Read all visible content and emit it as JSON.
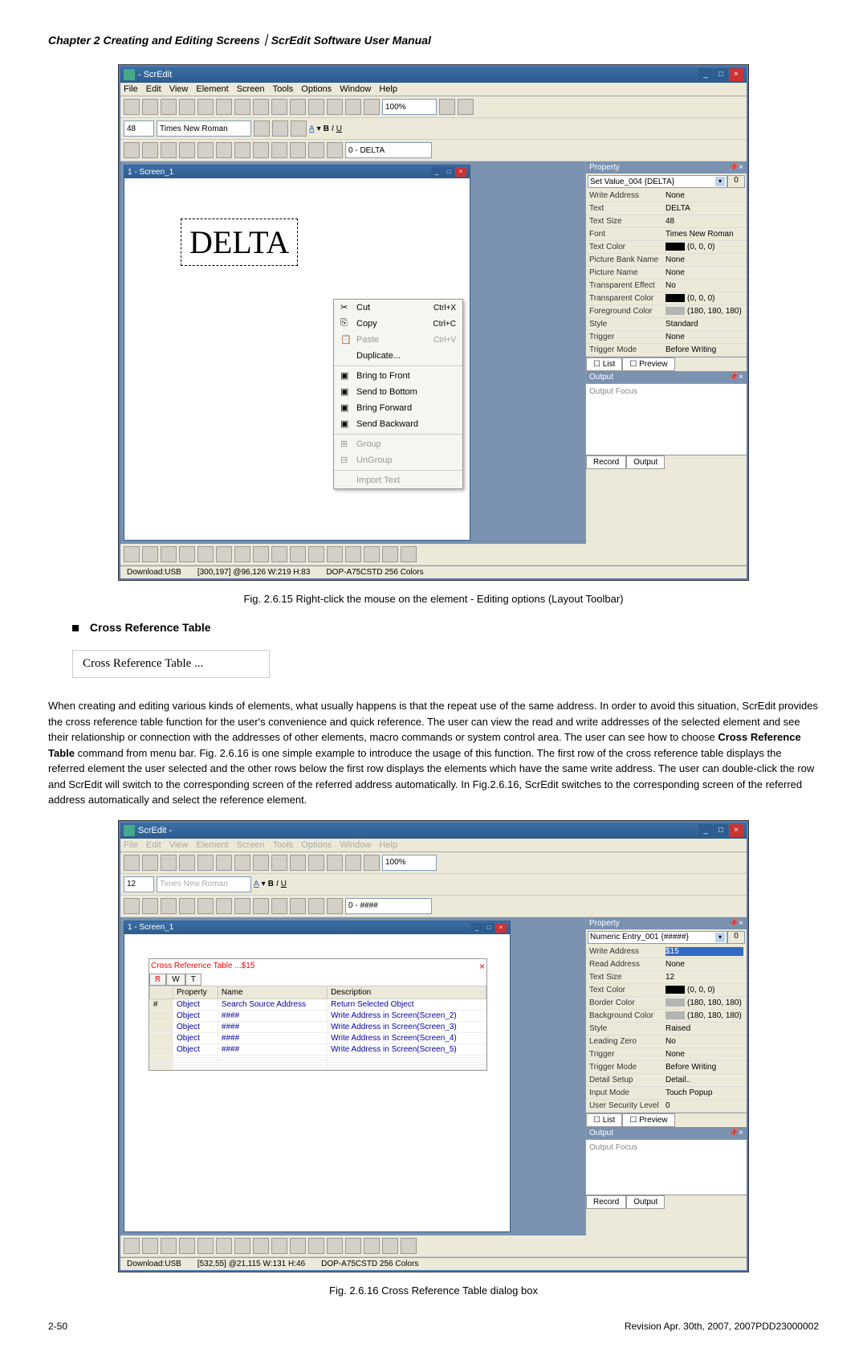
{
  "chapter_header": "Chapter 2  Creating and Editing Screens｜ScrEdit Software User Manual",
  "screenshot1": {
    "title": "- ScrEdit",
    "menubar": [
      "File",
      "Edit",
      "View",
      "Element",
      "Screen",
      "Tools",
      "Options",
      "Window",
      "Help"
    ],
    "zoom": "100%",
    "font_size": "48",
    "font_name": "Times New Roman",
    "screen_dropdown": "0 - DELTA",
    "inner_window_title": "1 - Screen_1",
    "element_text": "DELTA",
    "context_menu": [
      {
        "icon": "cut-icon",
        "label": "Cut",
        "shortcut": "Ctrl+X"
      },
      {
        "icon": "copy-icon",
        "label": "Copy",
        "shortcut": "Ctrl+C"
      },
      {
        "icon": "paste-icon",
        "label": "Paste",
        "shortcut": "Ctrl+V",
        "disabled": true
      },
      {
        "label": "Duplicate..."
      },
      {
        "divider": true
      },
      {
        "icon": "front-icon",
        "label": "Bring to Front"
      },
      {
        "icon": "bottom-icon",
        "label": "Send to Bottom"
      },
      {
        "icon": "forward-icon",
        "label": "Bring Forward"
      },
      {
        "icon": "backward-icon",
        "label": "Send Backward"
      },
      {
        "divider": true
      },
      {
        "icon": "group-icon",
        "label": "Group",
        "disabled": true
      },
      {
        "icon": "ungroup-icon",
        "label": "UnGroup",
        "disabled": true
      },
      {
        "divider": true
      },
      {
        "label": "Import Text",
        "disabled": true
      }
    ],
    "property_panel": {
      "header": "Property",
      "dropdown": "Set Value_004 {DELTA}",
      "dropdown_value": "0",
      "rows": [
        {
          "label": "Write Address",
          "value": "None"
        },
        {
          "label": "Text",
          "value": "DELTA",
          "highlighted": true
        },
        {
          "label": "Text Size",
          "value": "48"
        },
        {
          "label": "Font",
          "value": "Times New Roman"
        },
        {
          "label": "Text Color",
          "value": "(0, 0, 0)",
          "color": "black"
        },
        {
          "label": "Picture Bank Name",
          "value": "None"
        },
        {
          "label": "Picture Name",
          "value": "None"
        },
        {
          "label": "Transparent Effect",
          "value": "No"
        },
        {
          "label": "Transparent Color",
          "value": "(0, 0, 0)",
          "color": "black"
        },
        {
          "label": "Foreground Color",
          "value": "(180, 180, 180)",
          "color": "gray"
        },
        {
          "label": "Style",
          "value": "Standard"
        },
        {
          "label": "Trigger",
          "value": "None"
        },
        {
          "label": "Trigger Mode",
          "value": "Before Writing"
        }
      ],
      "tabs": [
        "List",
        "Preview"
      ]
    },
    "output_panel": {
      "header": "Output",
      "content": "Output Focus",
      "tabs": [
        "Record",
        "Output"
      ]
    },
    "statusbar": {
      "download": "Download:USB",
      "coords": "[300,197] @96,126 W:219 H:83",
      "device": "DOP-A75CSTD 256 Colors"
    }
  },
  "figure1_caption": "Fig. 2.6.15 Right-click the mouse on the element - Editing options (Layout Toolbar)",
  "section_title": "Cross Reference Table",
  "crt_label": "Cross Reference Table ...",
  "body_paragraph": "When creating and editing various kinds of elements, what usually happens is that the repeat use of the same address. In order to avoid this situation, ScrEdit provides the cross reference table function for the user's convenience and quick reference. The user can view the read and write addresses of the selected element and see their relationship or connection with the addresses of other elements, macro commands or system control area. The user can see how to choose ",
  "body_bold": "Cross Reference Table",
  "body_paragraph2": " command from menu bar. Fig. 2.6.16 is one simple example to introduce the usage of this function. The first row of the cross reference table displays the referred element the user selected and the other rows below the first row displays the elements which have the same write address. The user can double-click the row and ScrEdit will switch to the corresponding screen of the referred address automatically. In Fig.2.6.16, ScrEdit switches to the corresponding screen of the referred address automatically and select the reference element.",
  "screenshot2": {
    "title": "ScrEdit -",
    "menubar": [
      "File",
      "Edit",
      "View",
      "Element",
      "Screen",
      "Tools",
      "Options",
      "Window",
      "Help"
    ],
    "zoom": "100%",
    "font_size": "12",
    "font_name": "Times New Roman",
    "screen_dropdown": "0 - ####",
    "inner_window_title": "1 - Screen_1",
    "crt_window": {
      "title": "Cross Reference Table ...$15",
      "tabs": [
        "R",
        "W",
        "T"
      ],
      "columns": [
        "Property",
        "Name",
        "Description"
      ],
      "rows": [
        {
          "num": "#",
          "property": "Object",
          "name": "Search Source Address",
          "desc": "Return Selected Object"
        },
        {
          "property": "Object",
          "name": "####",
          "desc": "Write Address in Screen(Screen_2)"
        },
        {
          "property": "Object",
          "name": "####",
          "desc": "Write Address in Screen(Screen_3)"
        },
        {
          "property": "Object",
          "name": "####",
          "desc": "Write Address in Screen(Screen_4)"
        },
        {
          "property": "Object",
          "name": "####",
          "desc": "Write Address in Screen(Screen_5)"
        }
      ]
    },
    "property_panel": {
      "header": "Property",
      "dropdown": "Numeric Entry_001 {#####}",
      "dropdown_value": "0",
      "rows": [
        {
          "label": "Write Address",
          "value": "$15",
          "highlighted": true
        },
        {
          "label": "Read Address",
          "value": "None"
        },
        {
          "label": "Text Size",
          "value": "12"
        },
        {
          "label": "Text Color",
          "value": "(0, 0, 0)",
          "color": "black"
        },
        {
          "label": "Border Color",
          "value": "(180, 180, 180)",
          "color": "gray"
        },
        {
          "label": "Background Color",
          "value": "(180, 180, 180)",
          "color": "gray"
        },
        {
          "label": "Style",
          "value": "Raised"
        },
        {
          "label": "Leading Zero",
          "value": "No"
        },
        {
          "label": "Trigger",
          "value": "None"
        },
        {
          "label": "Trigger Mode",
          "value": "Before Writing"
        },
        {
          "label": "Detail Setup",
          "value": "Detail.."
        },
        {
          "label": "Input Mode",
          "value": "Touch Popup"
        },
        {
          "label": "User Security Level",
          "value": "0"
        }
      ],
      "tabs": [
        "List",
        "Preview"
      ]
    },
    "output_panel": {
      "header": "Output",
      "content": "Output Focus",
      "tabs": [
        "Record",
        "Output"
      ]
    },
    "statusbar": {
      "download": "Download:USB",
      "coords": "[532,55] @21,115 W:131 H:46",
      "device": "DOP-A75CSTD 256 Colors"
    }
  },
  "figure2_caption": "Fig. 2.6.16 Cross Reference Table dialog box",
  "footer": {
    "page": "2-50",
    "revision": "Revision Apr. 30th, 2007, 2007PDD23000002"
  }
}
